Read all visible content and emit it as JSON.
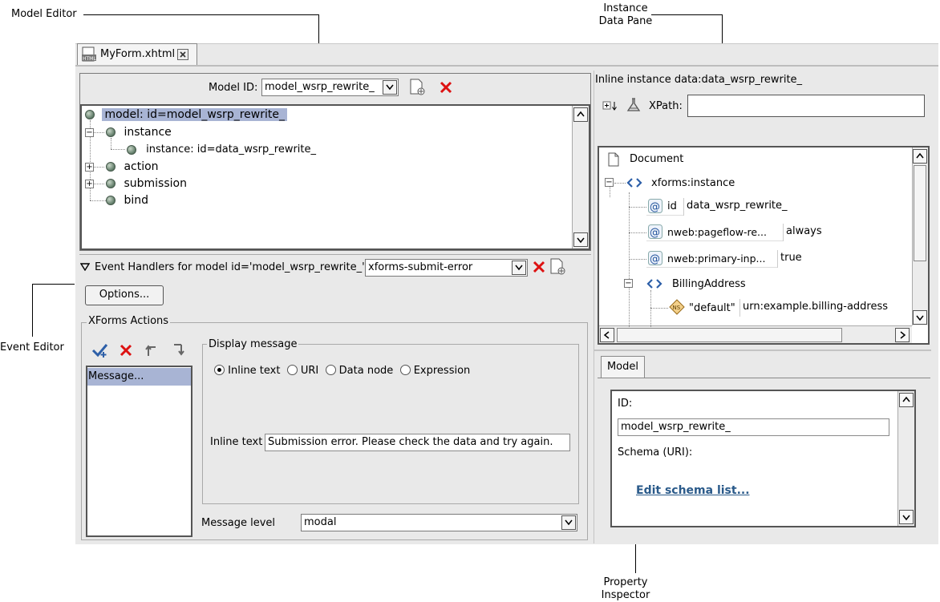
{
  "callouts": {
    "model_editor": "Model Editor",
    "instance_line1": "Instance",
    "instance_line2": "Data Pane",
    "event_editor": "Event Editor",
    "property_line1": "Property",
    "property_line2": "Inspector"
  },
  "editor_tab": {
    "label": "MyForm.xhtml"
  },
  "model_editor": {
    "model_id_label": "Model ID:",
    "model_id_value": "model_wsrp_rewrite_",
    "tree": [
      {
        "label": "model: id=model_wsrp_rewrite_",
        "selected": true
      },
      {
        "label": "instance"
      },
      {
        "label": "instance: id=data_wsrp_rewrite_"
      },
      {
        "label": "action"
      },
      {
        "label": "submission"
      },
      {
        "label": "bind"
      }
    ]
  },
  "event_editor": {
    "header_label": "Event Handlers for model id='model_wsrp_rewrite_'",
    "event_value": "xforms-submit-error",
    "options_button": "Options...",
    "actions_group": "XForms Actions",
    "actions_list": [
      "Message..."
    ],
    "display_group": "Display message",
    "radio_options": [
      {
        "label": "Inline text",
        "checked": true
      },
      {
        "label": "URI",
        "checked": false
      },
      {
        "label": "Data node",
        "checked": false
      },
      {
        "label": "Expression",
        "checked": false
      }
    ],
    "inline_text_label": "Inline text",
    "inline_text_value": "Submission error. Please check the data and try again.",
    "message_level_label": "Message level",
    "message_level_value": "modal"
  },
  "instance_pane": {
    "title": "Inline instance data:data_wsrp_rewrite_",
    "xpath_label": "XPath:",
    "xpath_value": "",
    "tree": {
      "document": "Document",
      "root": "xforms:instance",
      "attrs": [
        {
          "name": "id",
          "value": "data_wsrp_rewrite_"
        },
        {
          "name": "nweb:pageflow-re...",
          "value": "always"
        },
        {
          "name": "nweb:primary-inp...",
          "value": "true"
        }
      ],
      "child": "BillingAddress",
      "ns": {
        "name": "\"default\"",
        "value": "urn:example.billing-address"
      }
    }
  },
  "property_inspector": {
    "tab": "Model",
    "id_label": "ID:",
    "id_value": "model_wsrp_rewrite_",
    "schema_label": "Schema (URI):",
    "edit_link": "Edit schema list..."
  }
}
